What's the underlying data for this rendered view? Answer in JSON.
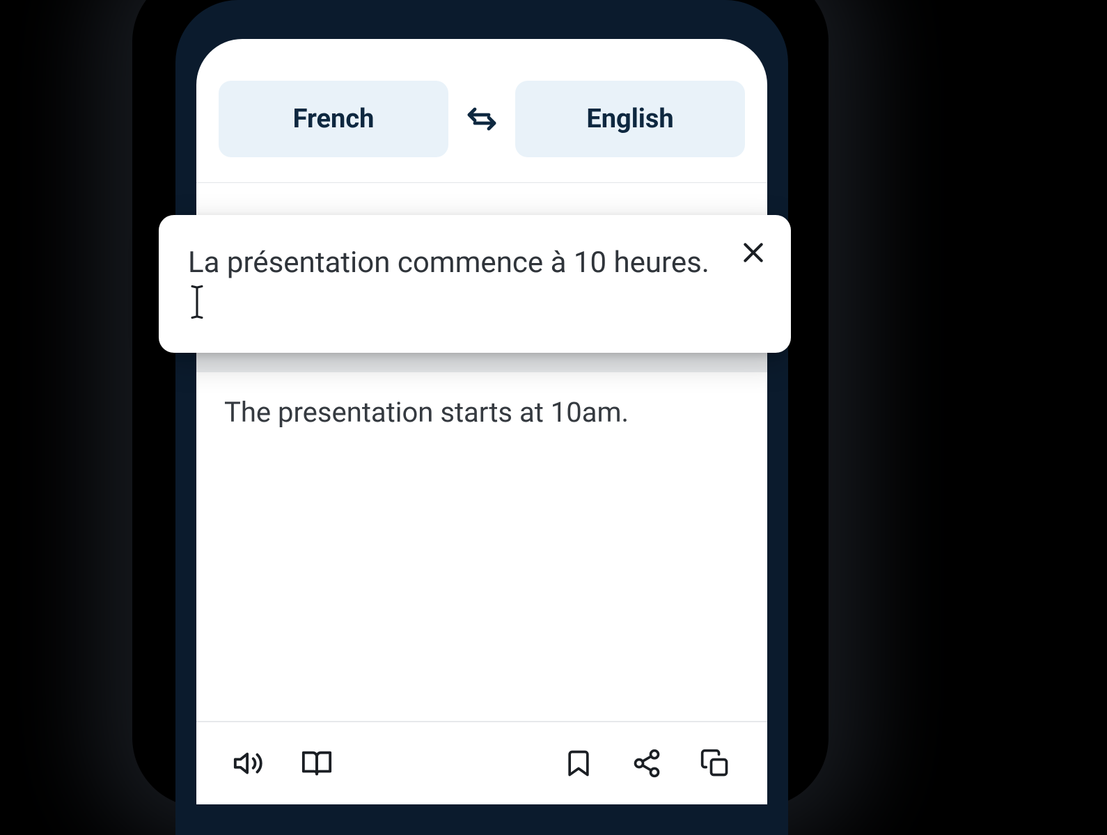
{
  "languages": {
    "source": "French",
    "target": "English"
  },
  "input": {
    "text": "La présentation commence à 10 heures."
  },
  "output": {
    "text": "The presentation starts at 10am."
  },
  "icons": {
    "swap": "swap-icon",
    "close": "close-icon",
    "speaker": "speaker-icon",
    "dictionary": "book-open-icon",
    "bookmark": "bookmark-icon",
    "share": "share-icon",
    "copy": "copy-icon"
  },
  "colors": {
    "frame": "#0b1b2d",
    "pill_bg": "#e9f2f9",
    "text_dark": "#0e2840",
    "body_text": "#353a40"
  }
}
